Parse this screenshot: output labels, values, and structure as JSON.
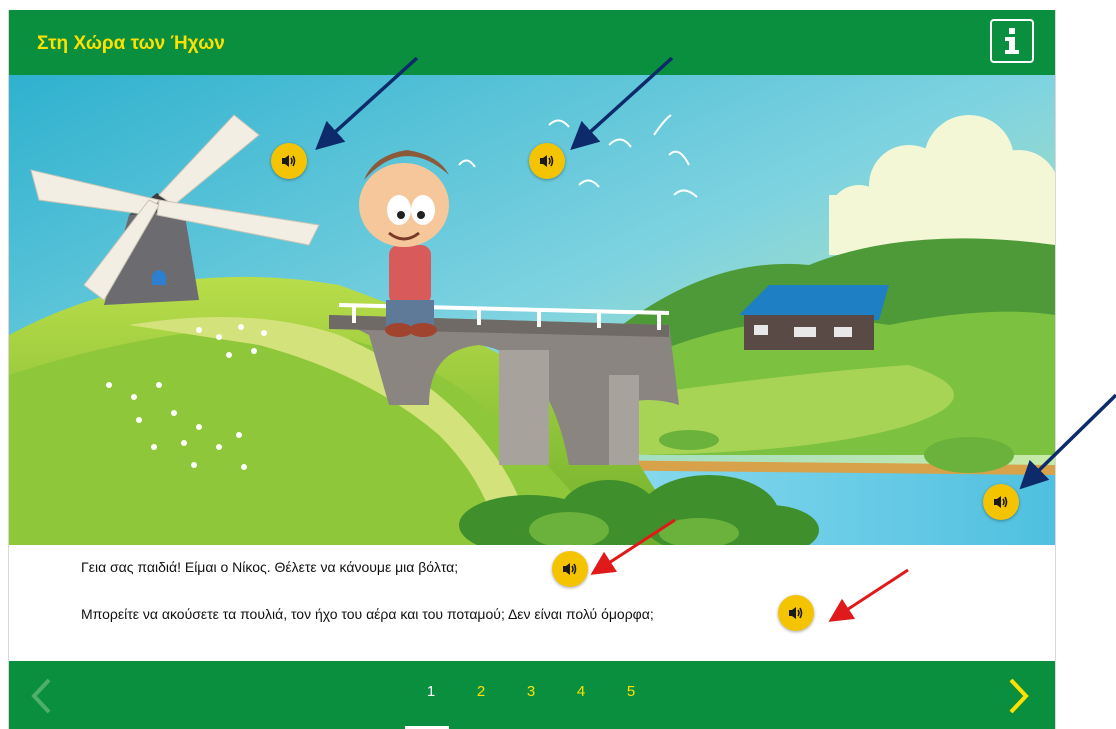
{
  "header": {
    "title": "Στη Χώρα των Ήχων",
    "info_icon": "info-icon"
  },
  "scene": {
    "sound_icon": "speaker-icon"
  },
  "text": {
    "line1": "Γεια σας παιδιά! Είμαι ο Νίκος. Θέλετε να κάνουμε μια βόλτα;",
    "line2": "Μπορείτε να ακούσετε τα πουλιά, τον ήχο του αέρα και του ποταμού; Δεν είναι πολύ όμορφα;"
  },
  "pagination": {
    "pages": [
      "1",
      "2",
      "3",
      "4",
      "5"
    ],
    "current": "1"
  },
  "colors": {
    "header_bg": "#0a8f3f",
    "title": "#ffe000",
    "sound_button": "#f5c400",
    "arrow_blue": "#0d2a6b",
    "arrow_red": "#e01a1a"
  }
}
